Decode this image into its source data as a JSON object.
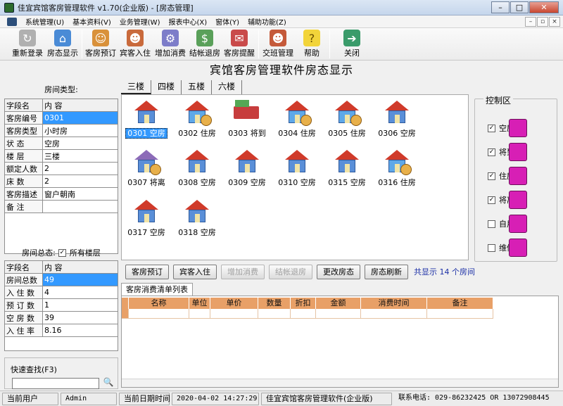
{
  "window": {
    "title": "佳宜宾馆客房管理软件 v1.70(企业版) - [房态管理]",
    "min": "–",
    "max": "□",
    "close": "✕"
  },
  "menu": [
    "系统管理(U)",
    "基本资料(V)",
    "业务管理(W)",
    "报表中心(X)",
    "窗体(Y)",
    "辅助功能(Z)"
  ],
  "mdi": [
    "–",
    "▫",
    "×"
  ],
  "toolbar": [
    {
      "label": "重新登录",
      "icon": "relogin-icon",
      "color": "#b0b0b0",
      "glyph": "↻"
    },
    {
      "label": "房态显示",
      "icon": "room-status-icon",
      "color": "#4a8bd6",
      "glyph": "⌂"
    },
    {
      "label": "客房预订",
      "icon": "booking-icon",
      "color": "#d9913a",
      "glyph": "☺"
    },
    {
      "label": "宾客入住",
      "icon": "checkin-icon",
      "color": "#c96a3c",
      "glyph": "☻"
    },
    {
      "label": "增加消费",
      "icon": "add-consume-icon",
      "color": "#7d7dc9",
      "glyph": "⚙"
    },
    {
      "label": "结帐退房",
      "icon": "checkout-icon",
      "color": "#5aa05a",
      "glyph": "$"
    },
    {
      "label": "客房提醒",
      "icon": "reminder-icon",
      "color": "#c94a4a",
      "glyph": "✉"
    },
    {
      "label": "交班管理",
      "icon": "shift-icon",
      "color": "#c55a3a",
      "glyph": "☻"
    },
    {
      "label": "帮助",
      "icon": "help-bulb-icon",
      "color": "#f2d43a",
      "glyph": "?"
    },
    {
      "label": "关闭",
      "icon": "exit-door-icon",
      "color": "#3a9b6a",
      "glyph": "➔"
    }
  ],
  "heading": "宾馆客房管理软件房态显示",
  "room_type": {
    "title": "房间类型:",
    "headers": [
      "字段名",
      "内  容"
    ],
    "rows": [
      {
        "k": "客房编号",
        "v": "0301"
      },
      {
        "k": "客房类型",
        "v": "小时房"
      },
      {
        "k": "状    态",
        "v": "空房"
      },
      {
        "k": "楼    层",
        "v": "三楼"
      },
      {
        "k": "额定人数",
        "v": "2"
      },
      {
        "k": "床    数",
        "v": "2"
      },
      {
        "k": "客房描述",
        "v": "窗户朝南"
      },
      {
        "k": "备    注",
        "v": ""
      }
    ]
  },
  "summary": {
    "title": "房间总态:",
    "all_floors_label": "所有楼层",
    "all_floors_checked": true,
    "headers": [
      "字段名",
      "内  容"
    ],
    "rows": [
      {
        "k": "房间总数",
        "v": "49"
      },
      {
        "k": "入 住 数",
        "v": "4"
      },
      {
        "k": "预 订 数",
        "v": "1"
      },
      {
        "k": "空 房 数",
        "v": "39"
      },
      {
        "k": "入 住 率",
        "v": "8.16"
      }
    ]
  },
  "floor_tabs": [
    "三楼",
    "四楼",
    "五楼",
    "六楼"
  ],
  "rooms": [
    {
      "label": "0301 空房",
      "status": "empty"
    },
    {
      "label": "0302 住房",
      "status": "occupied"
    },
    {
      "label": "0303 将到",
      "status": "arriving"
    },
    {
      "label": "0304 住房",
      "status": "occupied"
    },
    {
      "label": "0305 住房",
      "status": "occupied"
    },
    {
      "label": "0306 空房",
      "status": "empty"
    },
    {
      "label": "0307 将离",
      "status": "leaving"
    },
    {
      "label": "0308 空房",
      "status": "empty"
    },
    {
      "label": "0309 空房",
      "status": "empty"
    },
    {
      "label": "0310 空房",
      "status": "empty"
    },
    {
      "label": "0315 空房",
      "status": "empty"
    },
    {
      "label": "0316 住房",
      "status": "occupied"
    },
    {
      "label": "0317 空房",
      "status": "empty"
    },
    {
      "label": "0318 空房",
      "status": "empty"
    }
  ],
  "control": {
    "title": "控制区",
    "items": [
      {
        "label": "空房",
        "checked": true
      },
      {
        "label": "将到",
        "checked": true
      },
      {
        "label": "住房",
        "checked": true
      },
      {
        "label": "将离",
        "checked": true
      },
      {
        "label": "自用",
        "checked": false
      },
      {
        "label": "维修",
        "checked": false
      }
    ]
  },
  "actions": [
    {
      "label": "客房预订",
      "enabled": true
    },
    {
      "label": "宾客入住",
      "enabled": true
    },
    {
      "label": "增加消费",
      "enabled": false
    },
    {
      "label": "结帐退房",
      "enabled": false
    },
    {
      "label": "更改房态",
      "enabled": true
    },
    {
      "label": "房态刷新",
      "enabled": true
    }
  ],
  "room_count_text": "共显示 14 个房间",
  "consumption": {
    "tab": "客房消费清单列表",
    "columns": [
      "",
      "名称",
      "单位",
      "单价",
      "数量",
      "折扣",
      "金额",
      "消费时间",
      "备注"
    ]
  },
  "quick_search": {
    "label": "快速查找(F3)",
    "value": "",
    "button": "🔍"
  },
  "status_bar": {
    "user_label": "当前用户",
    "user": "Admin",
    "date_label": "当前日期时间",
    "datetime": "2020-04-02 14:27:29",
    "product": "佳宜宾馆客房管理软件(企业版)",
    "contact": "联系电话:  029-86232425  OR  13072908445"
  }
}
